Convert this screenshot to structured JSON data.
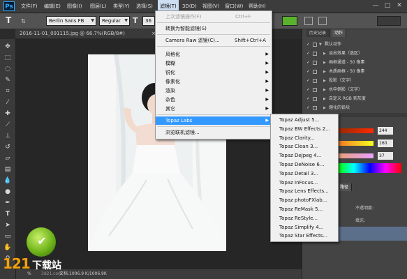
{
  "app": {
    "logo": "Ps"
  },
  "menubar": {
    "items": [
      "文件(F)",
      "编辑(E)",
      "图像(I)",
      "图层(L)",
      "类型(Y)",
      "选择(S)",
      "滤镜(T)",
      "3D(D)",
      "视图(V)",
      "窗口(W)",
      "帮助(H)"
    ],
    "window_controls": [
      "—",
      "□",
      "✕"
    ]
  },
  "options_bar": {
    "tool_glyph": "T",
    "font_family": "Berlin Sans FB",
    "font_style": "Regular",
    "font_size": "36"
  },
  "document": {
    "tab_title": "2016-11-01_091115.jpg @ 66.7%(RGB/8#)",
    "tab_close": "×"
  },
  "status": {
    "zoom": "%",
    "doc_info": "文档:1006.9 K/1006.9K"
  },
  "filter_menu": {
    "items": [
      {
        "label": "上次滤镜操作(F)",
        "shortcut": "Ctrl+F",
        "state": "disabled"
      },
      {
        "label": "转换为智能滤镜(S)",
        "shortcut": "",
        "state": "normal"
      },
      {
        "label": "Camera Raw 滤镜(C)...",
        "shortcut": "Shift+Ctrl+A",
        "state": "normal"
      },
      {
        "label": "风格化",
        "submenu": true
      },
      {
        "label": "模糊",
        "submenu": true
      },
      {
        "label": "锐化",
        "submenu": true
      },
      {
        "label": "像素化",
        "submenu": true
      },
      {
        "label": "渲染",
        "submenu": true
      },
      {
        "label": "杂色",
        "submenu": true
      },
      {
        "label": "其它",
        "submenu": true
      },
      {
        "label": "Topaz Labs",
        "submenu": true,
        "state": "highlighted"
      },
      {
        "label": "浏览联机滤镜...",
        "shortcut": "",
        "state": "normal"
      }
    ]
  },
  "topaz_submenu": {
    "items": [
      "Topaz Adjust 5...",
      "Topaz BW Effects 2...",
      "Topaz Clarity...",
      "Topaz Clean 3...",
      "Topaz DeJpeg 4...",
      "Topaz DeNoise 6...",
      "Topaz Detail 3...",
      "Topaz InFocus...",
      "Topaz Lens Effects...",
      "Topaz photoFXlab...",
      "Topaz ReMask 5...",
      "Topaz ReStyle...",
      "Topaz Simplify 4...",
      "Topaz Star Effects..."
    ]
  },
  "panels": {
    "tabs": [
      "历史记录",
      "动作"
    ],
    "actions": [
      {
        "label": "默认动作",
        "expanded": true
      },
      {
        "label": "淡出效果（选区）"
      },
      {
        "label": "画框通道 - 50 像素"
      },
      {
        "label": "木质画框 - 50 像素"
      },
      {
        "label": "投影（文字）"
      },
      {
        "label": "水中倒影（文字）"
      },
      {
        "label": "自定义 RGB 到灰度"
      },
      {
        "label": "熔化的铅块"
      }
    ],
    "color_values": [
      "244",
      "160",
      "37"
    ],
    "layers_tab": "路径",
    "opacity_label": "不透明度:",
    "fill_label": "填充:"
  },
  "watermark": {
    "number": "121",
    "text": "下载站",
    "url": "3d21.com"
  },
  "colors": {
    "accent": "#3399ff",
    "ps_blue": "#31a8ff",
    "watermark_orange": "#f3a10b",
    "watermark_green": "#6fb41a"
  }
}
